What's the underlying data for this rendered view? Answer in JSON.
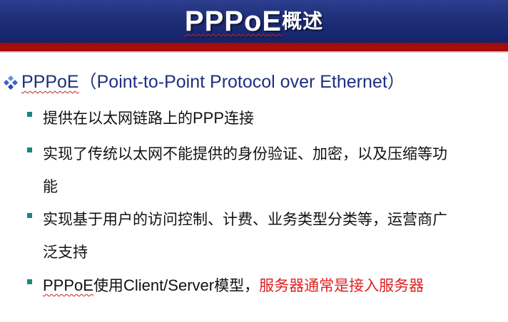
{
  "slide": {
    "title_prefix": "PPPoE",
    "title_suffix": "概述",
    "heading": {
      "acronym": "PPPoE",
      "expansion": "（Point-to-Point Protocol over Ethernet）"
    },
    "bullets": [
      {
        "part1": "提供在以太网链路上的",
        "part2": "PPP",
        "part3": "连接"
      },
      {
        "line1": "实现了传统以太网不能提供的身份验证、加密，以及压缩等功",
        "line2": "能"
      },
      {
        "line1": "实现基于用户的访问控制、计费、业务类型分类等，运营商广",
        "line2": "泛支持"
      },
      {
        "part1": "PPPoE",
        "part2": "使用",
        "part3": "Client/Server",
        "part4": "模型，",
        "highlight": "服务器通常是接入服务器"
      }
    ]
  },
  "colors": {
    "title_bar": "#1f2f78",
    "accent_band": "#a50c0c",
    "heading_text": "#1f2f80",
    "bullet": "#17877d",
    "highlight": "#e02020"
  },
  "icons": {
    "heading_marker": "diamond-cluster-icon",
    "bullet_marker": "square-bullet-icon"
  }
}
